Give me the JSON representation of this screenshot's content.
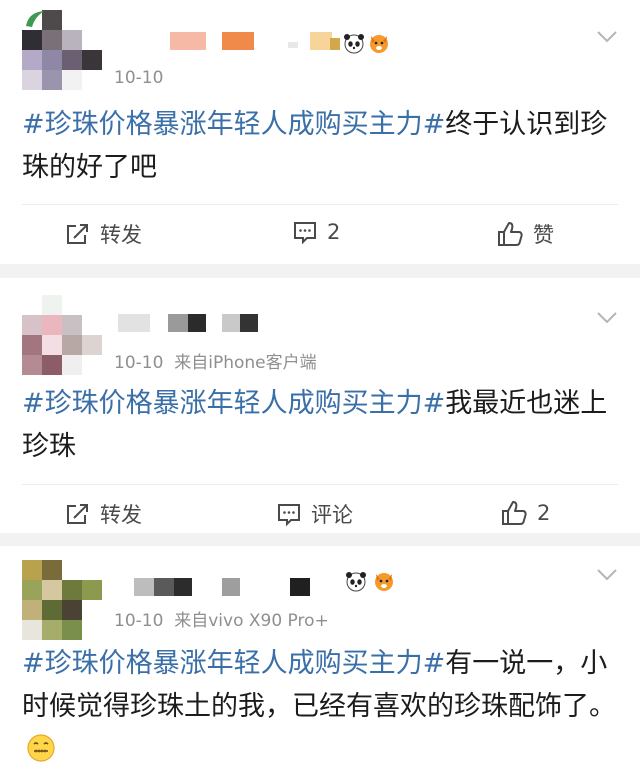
{
  "posts": [
    {
      "time": "10-10",
      "source": "",
      "hashtag": "#珍珠价格暴涨年轻人成购买主力#",
      "body": "终于认识到珍珠的好了吧",
      "actions": {
        "repost_label": "转发",
        "comment_label": "2",
        "like_label": "赞"
      }
    },
    {
      "time": "10-10",
      "source": "来自iPhone客户端",
      "hashtag": "#珍珠价格暴涨年轻人成购买主力#",
      "body": "我最近也迷上珍珠",
      "actions": {
        "repost_label": "转发",
        "comment_label": "评论",
        "like_label": "2"
      }
    },
    {
      "time": "10-10",
      "source": "来自vivo X90 Pro+",
      "hashtag": "#珍珠价格暴涨年轻人成购买主力#",
      "body": "有一说一，小时候觉得珍珠土的我，已经有喜欢的珍珠配饰了。",
      "emoji": "smile-zipper-emoji"
    }
  ],
  "colors": {
    "hashtag": "#3a6fa8",
    "text": "#1c1c1c",
    "muted": "#8f8f8f",
    "divider": "#f2f2f2"
  },
  "icons": [
    "expand-chevron-icon",
    "repost-icon",
    "comment-icon",
    "like-icon",
    "panda-emoji",
    "fox-emoji"
  ]
}
